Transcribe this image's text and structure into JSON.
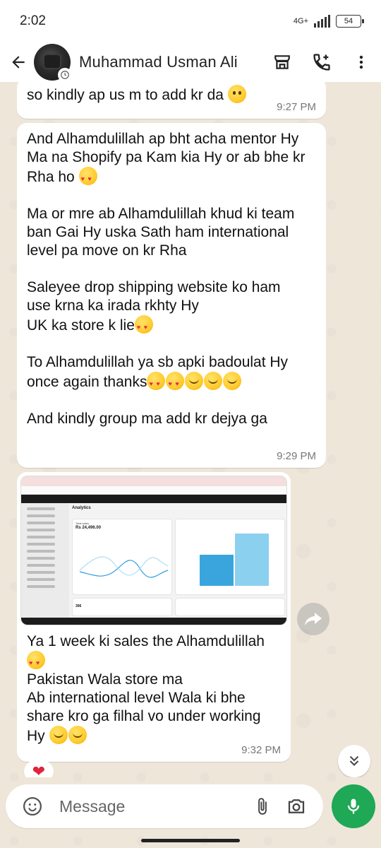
{
  "status": {
    "time": "2:02",
    "network": "4G+",
    "battery": "54"
  },
  "header": {
    "contact_name": "Muhammad Usman Ali"
  },
  "messages": [
    {
      "line1": "so kindly ap us m to add kr da",
      "time": "9:27 PM"
    },
    {
      "p1a": "And Alhamdulillah ap bht acha mentor Hy",
      "p1b": "Ma na Shopify pa Kam kia Hy or ab bhe kr",
      "p1c": "Rha ho",
      "p2a": "Ma or mre ab Alhamdulillah khud ki team",
      "p2b": "ban Gai Hy uska Sath ham international",
      "p2c": "level pa move on kr Rha",
      "p3a": "Saleyee drop shipping website ko ham",
      "p3b": "use krna ka irada rkhty Hy",
      "p3c": "UK ka store k lie",
      "p4a": "To Alhamdulillah ya sb apki badoulat Hy",
      "p4b": "once again thanks",
      "p5": "And kindly group ma add kr dejya ga",
      "time": "9:29 PM"
    },
    {
      "c1": "Ya 1 week ki sales the Alhamdulillah",
      "c2": "Pakistan Wala store ma",
      "c3": "Ab international level Wala ki bhe",
      "c4": "share kro ga filhal vo under working",
      "c5": "Hy",
      "time": "9:32 PM",
      "reaction": "❤",
      "screenshot": {
        "app": "shopify",
        "page_title": "Analytics",
        "total_sales_label": "Total sales",
        "total_sales_value": "Rs 24,496.00",
        "sessions_value": "306"
      }
    }
  ],
  "composer": {
    "placeholder": "Message"
  }
}
